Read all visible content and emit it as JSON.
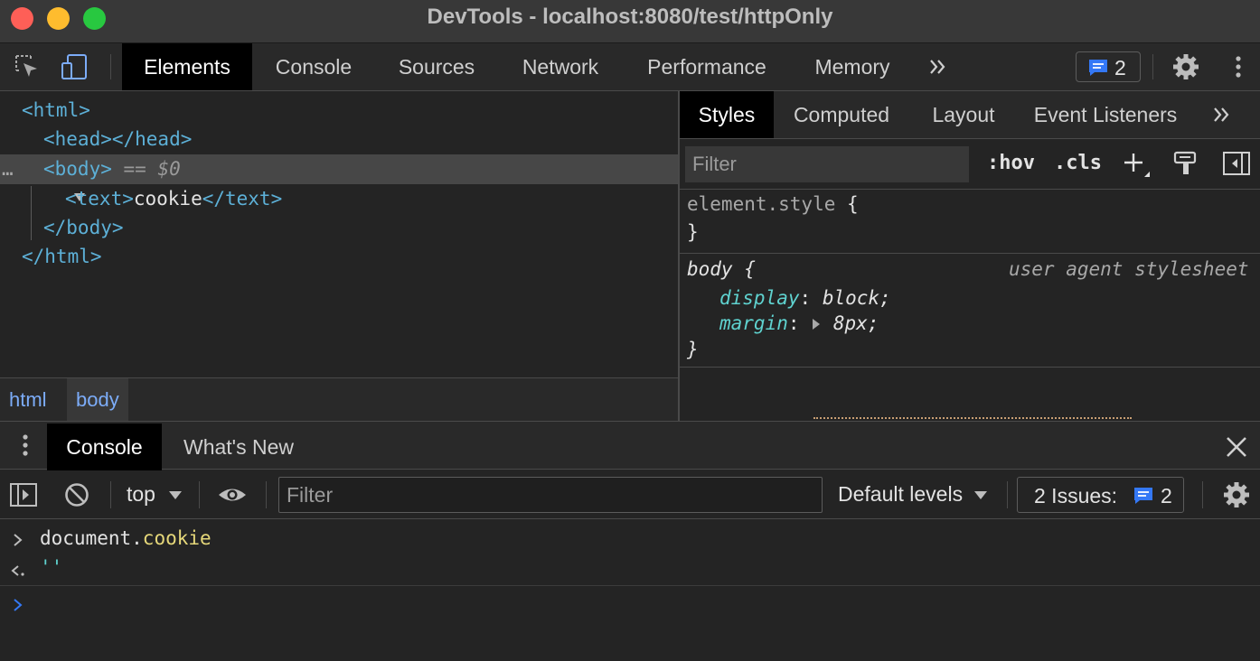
{
  "window": {
    "title": "DevTools - localhost:8080/test/httpOnly"
  },
  "main_tabs": [
    "Elements",
    "Console",
    "Sources",
    "Network",
    "Performance",
    "Memory"
  ],
  "issues_count": "2",
  "dom": {
    "html_open": "<html>",
    "head": "<head></head>",
    "body_open": "<body>",
    "body_marker": "== $0",
    "text_open": "<text>",
    "text_content": "cookie",
    "text_close": "</text>",
    "body_close": "</body>",
    "html_close": "</html>",
    "row_dots": "…"
  },
  "breadcrumbs": [
    "html",
    "body"
  ],
  "styles_tabs": [
    "Styles",
    "Computed",
    "Layout",
    "Event Listeners"
  ],
  "styles_filter": {
    "placeholder": "Filter",
    "hov": ":hov",
    "cls": ".cls"
  },
  "rules": {
    "element_style": {
      "selector": "element.style",
      "open": "{",
      "close": "}"
    },
    "body": {
      "selector": "body",
      "open": "{",
      "origin": "user agent stylesheet",
      "display_prop": "display",
      "display_val": "block;",
      "margin_prop": "margin",
      "margin_val": "8px;",
      "close": "}"
    }
  },
  "drawer_tabs": [
    "Console",
    "What's New"
  ],
  "console_toolbar": {
    "context": "top",
    "filter_placeholder": "Filter",
    "levels": "Default levels",
    "issues_label": "2 Issues:",
    "issues_count": "2"
  },
  "console": {
    "input_obj": "document.",
    "input_prop": "cookie",
    "result": "''"
  },
  "colors": {
    "accent_blue": "#3478f6",
    "tag_blue": "#5db0d7",
    "prop_teal": "#5fd2cf"
  }
}
